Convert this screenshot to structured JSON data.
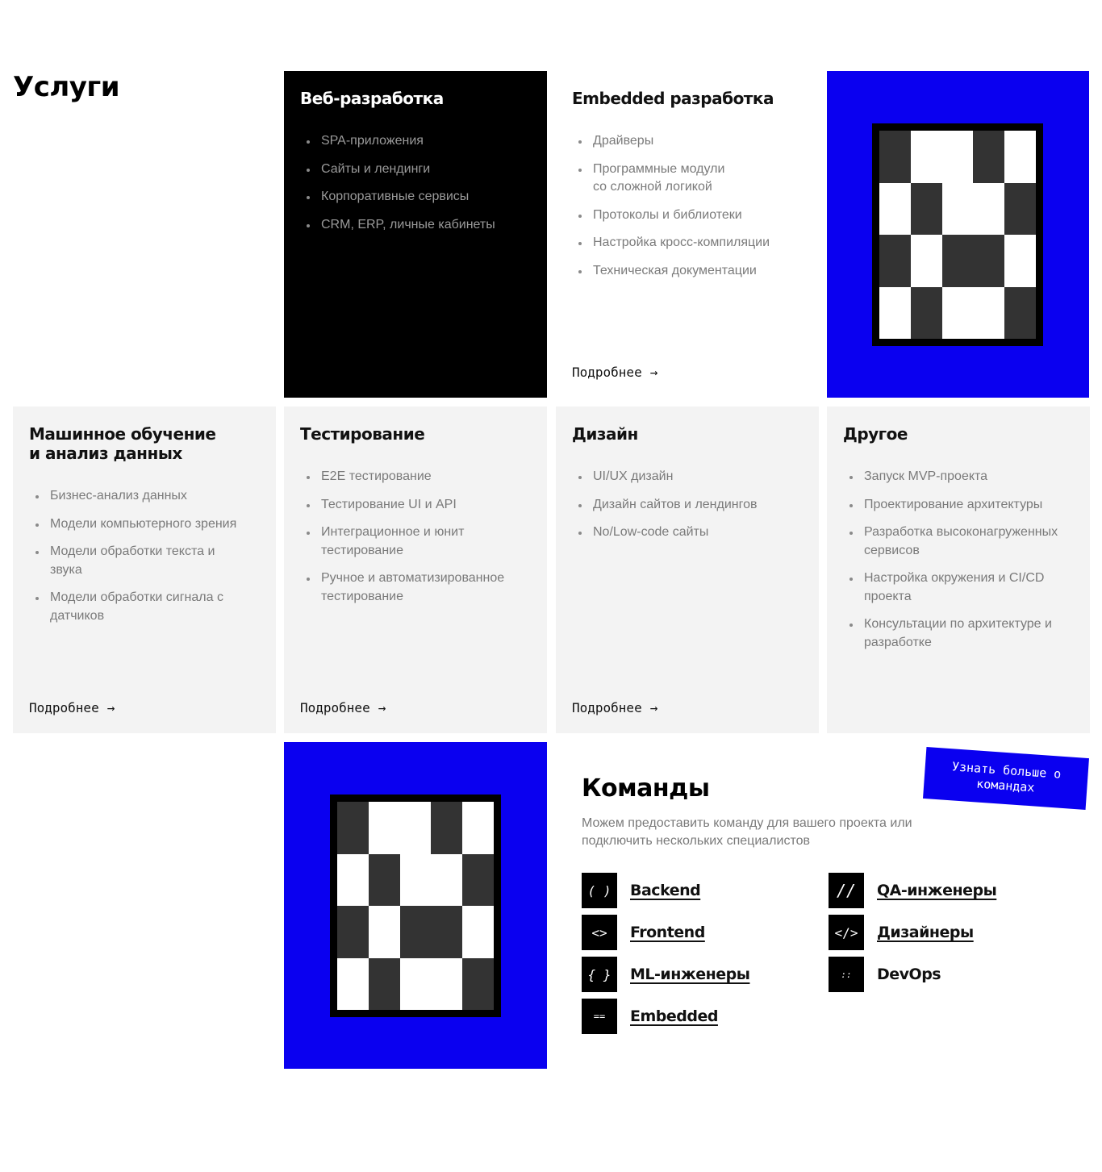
{
  "page_title": "Услуги",
  "more_label": "Подробнее",
  "arrow": "→",
  "cards": {
    "web": {
      "title": "Веб-разработка",
      "items": [
        "SPA-приложения",
        "Сайты и лендинги",
        "Корпоративные сервисы",
        "CRM, ERP, личные кабинеты"
      ]
    },
    "embedded": {
      "title": "Embedded разработка",
      "items": [
        "Драйверы",
        "Программные модули со сложной логикой",
        "Протоколы и библиотеки",
        "Настройка кросс-компиляции",
        "Техническая документации"
      ]
    },
    "ml": {
      "title_line1": "Машинное обучение",
      "title_line2": "и анализ данных",
      "items": [
        "Бизнес-анализ данных",
        "Модели компьютерного зрения",
        "Модели обработки текста и звука",
        "Модели обработки сигнала с датчиков"
      ]
    },
    "testing": {
      "title": "Тестирование",
      "items": [
        "E2E тестирование",
        "Тестирование UI и API",
        "Интеграционное и юнит тестирование",
        "Ручное и автоматизированное тестирование"
      ]
    },
    "design": {
      "title": "Дизайн",
      "items": [
        "UI/UX дизайн",
        "Дизайн сайтов и лендингов",
        "No/Low-code сайты"
      ]
    },
    "other": {
      "title": "Другое",
      "items": [
        "Запуск MVP-проекта",
        "Проектирование архитектуры",
        "Разработка высоконагруженных сервисов",
        "Настройка окружения и CI/CD проекта",
        "Консультации по архитектуре и разработке"
      ]
    }
  },
  "teams": {
    "title": "Команды",
    "subtitle": "Можем предоставить команду для вашего проекта или подключить нескольких специалистов",
    "sticker": "Узнать больше о командах",
    "items": [
      {
        "glyph": "( )",
        "label": "Backend"
      },
      {
        "glyph": "<>",
        "label": "Frontend"
      },
      {
        "glyph": "{ }",
        "label": "ML-инженеры"
      },
      {
        "glyph": "==",
        "label": "Embedded"
      },
      {
        "glyph": "//",
        "label": "QA-инженеры"
      },
      {
        "glyph": "</>",
        "label": "Дизайнеры"
      },
      {
        "glyph": "::",
        "label": "DevOps"
      }
    ]
  },
  "colors": {
    "accent_blue": "#0a00f0",
    "card_gray": "#f3f3f3",
    "muted_text": "#7a7a7a"
  }
}
